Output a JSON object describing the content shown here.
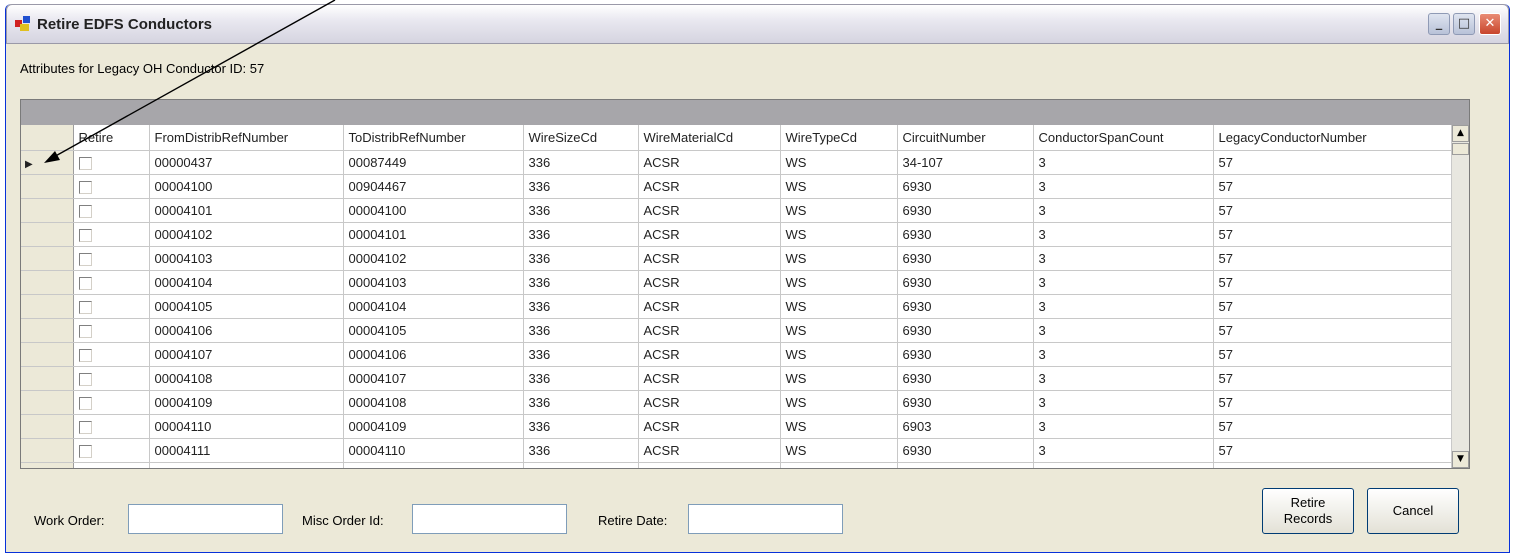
{
  "window": {
    "title": "Retire EDFS Conductors",
    "minimize_glyph": "_",
    "maximize_glyph": "□",
    "close_glyph": "✕"
  },
  "attributes_label": "Attributes for Legacy OH Conductor ID: 57",
  "grid": {
    "columns": [
      "",
      "Retire",
      "FromDistribRefNumber",
      "ToDistribRefNumber",
      "WireSizeCd",
      "WireMaterialCd",
      "WireTypeCd",
      "CircuitNumber",
      "ConductorSpanCount",
      "LegacyConductorNumber"
    ],
    "current_row_indicator": "▶",
    "rows": [
      {
        "from": "00000437",
        "to": "00087449",
        "size": "336",
        "material": "ACSR",
        "type": "WS",
        "circuit": "34-107",
        "span": "3",
        "legacy": "57"
      },
      {
        "from": "00004100",
        "to": "00904467",
        "size": "336",
        "material": "ACSR",
        "type": "WS",
        "circuit": "6930",
        "span": "3",
        "legacy": "57"
      },
      {
        "from": "00004101",
        "to": "00004100",
        "size": "336",
        "material": "ACSR",
        "type": "WS",
        "circuit": "6930",
        "span": "3",
        "legacy": "57"
      },
      {
        "from": "00004102",
        "to": "00004101",
        "size": "336",
        "material": "ACSR",
        "type": "WS",
        "circuit": "6930",
        "span": "3",
        "legacy": "57"
      },
      {
        "from": "00004103",
        "to": "00004102",
        "size": "336",
        "material": "ACSR",
        "type": "WS",
        "circuit": "6930",
        "span": "3",
        "legacy": "57"
      },
      {
        "from": "00004104",
        "to": "00004103",
        "size": "336",
        "material": "ACSR",
        "type": "WS",
        "circuit": "6930",
        "span": "3",
        "legacy": "57"
      },
      {
        "from": "00004105",
        "to": "00004104",
        "size": "336",
        "material": "ACSR",
        "type": "WS",
        "circuit": "6930",
        "span": "3",
        "legacy": "57"
      },
      {
        "from": "00004106",
        "to": "00004105",
        "size": "336",
        "material": "ACSR",
        "type": "WS",
        "circuit": "6930",
        "span": "3",
        "legacy": "57"
      },
      {
        "from": "00004107",
        "to": "00004106",
        "size": "336",
        "material": "ACSR",
        "type": "WS",
        "circuit": "6930",
        "span": "3",
        "legacy": "57"
      },
      {
        "from": "00004108",
        "to": "00004107",
        "size": "336",
        "material": "ACSR",
        "type": "WS",
        "circuit": "6930",
        "span": "3",
        "legacy": "57"
      },
      {
        "from": "00004109",
        "to": "00004108",
        "size": "336",
        "material": "ACSR",
        "type": "WS",
        "circuit": "6930",
        "span": "3",
        "legacy": "57"
      },
      {
        "from": "00004110",
        "to": "00004109",
        "size": "336",
        "material": "ACSR",
        "type": "WS",
        "circuit": "6903",
        "span": "3",
        "legacy": "57"
      },
      {
        "from": "00004111",
        "to": "00004110",
        "size": "336",
        "material": "ACSR",
        "type": "WS",
        "circuit": "6930",
        "span": "3",
        "legacy": "57"
      }
    ],
    "scroll_up_glyph": "▲",
    "scroll_down_glyph": "▼"
  },
  "form": {
    "work_order_label": "Work Order:",
    "work_order_value": "",
    "misc_order_label": "Misc Order Id:",
    "misc_order_value": "",
    "retire_date_label": "Retire Date:",
    "retire_date_value": ""
  },
  "buttons": {
    "retire_records_line1": "Retire",
    "retire_records_line2": "Records",
    "cancel": "Cancel"
  }
}
